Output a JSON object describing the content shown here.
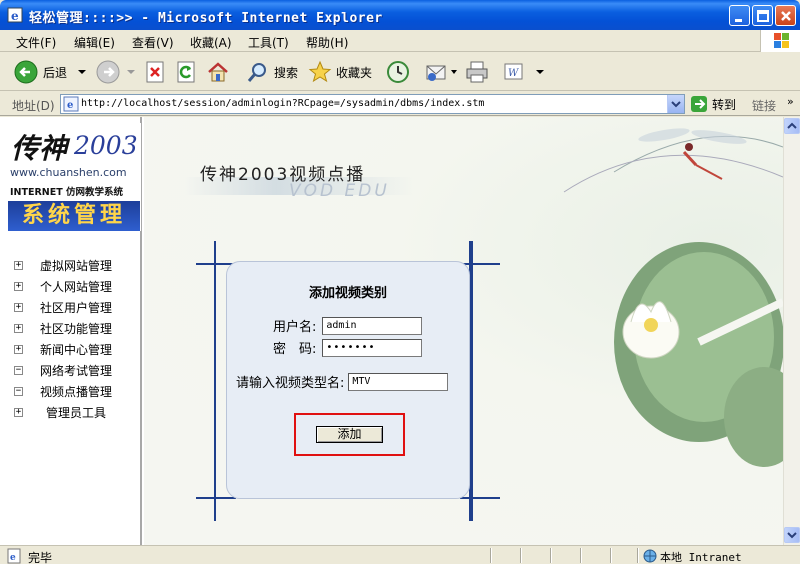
{
  "window": {
    "title": "轻松管理::::>> - Microsoft Internet Explorer"
  },
  "menu": [
    "文件(F)",
    "编辑(E)",
    "查看(V)",
    "收藏(A)",
    "工具(T)",
    "帮助(H)"
  ],
  "toolbar": {
    "back_label": "后退",
    "search_label": "搜索",
    "favorites_label": "收藏夹"
  },
  "address": {
    "label": "地址(D)",
    "url": "http://localhost/session/adminlogin?RCpage=/sysadmin/dbms/index.stm",
    "go_label": "转到",
    "links_label": "链接"
  },
  "sidebar": {
    "brand_name": "传神",
    "brand_year": "2003",
    "brand_url": "www.chuanshen.com",
    "brand_slogan": "INTERNET 仿网教学系统",
    "brand_banner": "系统管理",
    "items": [
      {
        "toggle": "+",
        "label": "虚拟网站管理"
      },
      {
        "toggle": "+",
        "label": "个人网站管理"
      },
      {
        "toggle": "+",
        "label": "社区用户管理"
      },
      {
        "toggle": "+",
        "label": "社区功能管理"
      },
      {
        "toggle": "+",
        "label": "新闻中心管理"
      },
      {
        "toggle": "−",
        "label": "网络考试管理"
      },
      {
        "toggle": "−",
        "label": "视频点播管理"
      },
      {
        "toggle": "+",
        "label": "管理员工具"
      }
    ]
  },
  "header": {
    "title": "传神2003视频点播",
    "subtitle": "VOD EDU"
  },
  "form": {
    "title": "添加视频类别",
    "username_label": "用户名:",
    "username_value": "admin",
    "password_label": "密　码:",
    "password_value": "•••••••",
    "category_label": "请输入视频类型名:",
    "category_value": "MTV",
    "submit_label": "添加"
  },
  "status": {
    "text": "完毕",
    "zone": "本地 Intranet"
  },
  "colors": {
    "titlebar": "#0a5fe0",
    "highlight": "#e01010",
    "frame_blue": "#1f3f8c"
  }
}
